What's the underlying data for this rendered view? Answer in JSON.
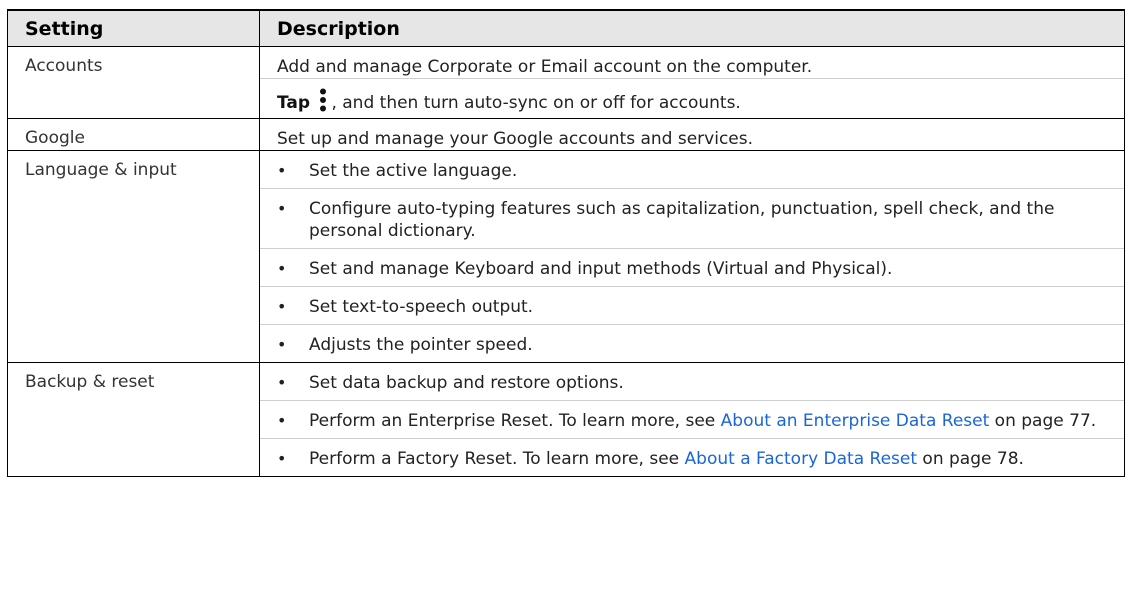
{
  "table": {
    "headers": {
      "setting": "Setting",
      "description": "Description"
    },
    "accounts": {
      "setting": "Accounts",
      "line1": "Add and manage Corporate or Email account on the computer.",
      "tap_word": "Tap",
      "tap_icon": "more-vert-icon",
      "tap_rest": ", and then turn auto-sync on or off for accounts."
    },
    "google": {
      "setting": "Google",
      "desc": "Set up and manage your Google accounts and services."
    },
    "language": {
      "setting": "Language & input",
      "bullets": [
        "Set the active language.",
        "Configure auto-typing features such as capitalization, punctuation, spell check, and the personal dictionary.",
        "Set and manage Keyboard and input methods (Virtual and Physical).",
        "Set text-to-speech output.",
        "Adjusts the pointer speed."
      ]
    },
    "backup": {
      "setting": "Backup & reset",
      "b1": "Set data backup and restore options.",
      "b2_pre": "Perform an Enterprise Reset. To learn more, see ",
      "b2_link": "About an Enterprise Data Reset",
      "b2_post": " on page 77.",
      "b3_pre": "Perform a Factory Reset. To learn more, see ",
      "b3_link": "About a Factory Data Reset",
      "b3_post": " on page 78."
    },
    "bullet_char": "•"
  }
}
